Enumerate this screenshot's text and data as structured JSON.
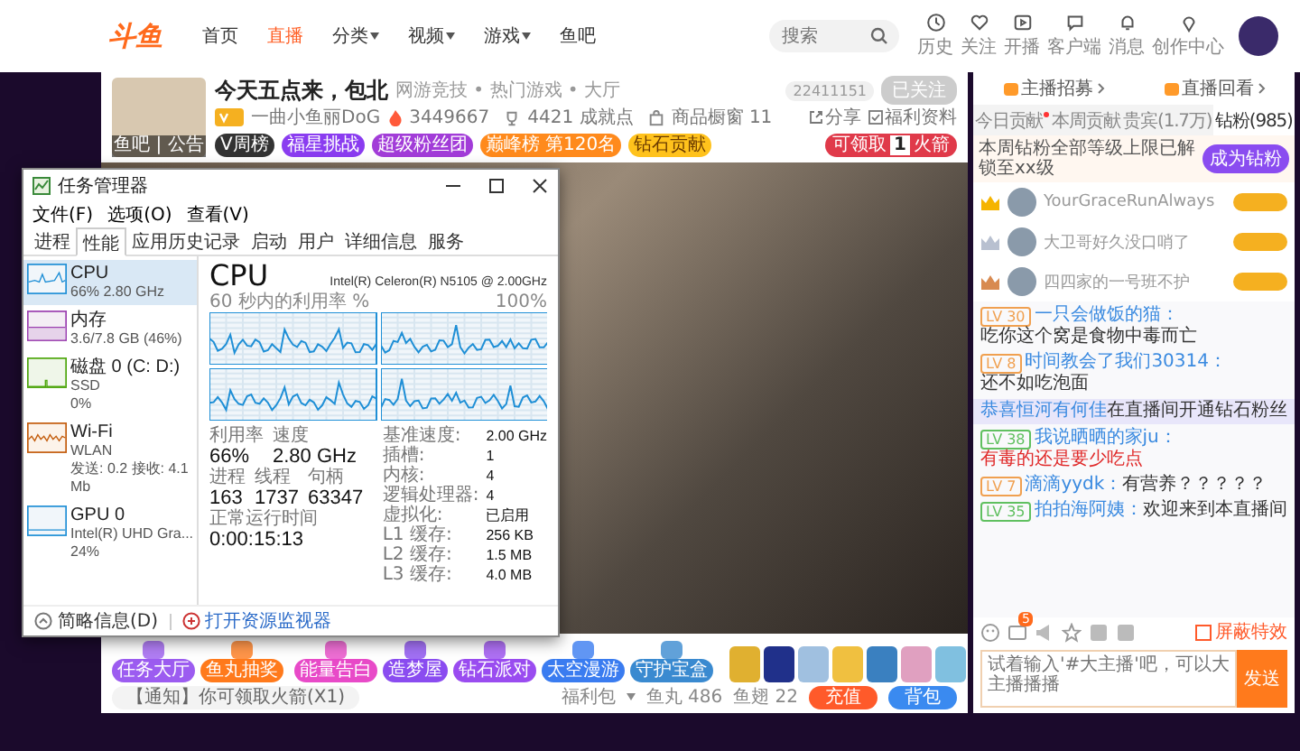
{
  "nav": {
    "logo": "斗鱼",
    "items": [
      {
        "label": "首页",
        "selected": false,
        "dropdown": false
      },
      {
        "label": "直播",
        "selected": true,
        "dropdown": false
      },
      {
        "label": "分类",
        "selected": false,
        "dropdown": true
      },
      {
        "label": "视频",
        "selected": false,
        "dropdown": true
      },
      {
        "label": "游戏",
        "selected": false,
        "dropdown": true
      },
      {
        "label": "鱼吧",
        "selected": false,
        "dropdown": false
      }
    ],
    "search": {
      "placeholder": "搜索"
    },
    "tools": [
      {
        "label": "历史",
        "kind": "clock"
      },
      {
        "label": "关注",
        "kind": "heart"
      },
      {
        "label": "开播",
        "kind": "play"
      },
      {
        "label": "客户端",
        "kind": "chat"
      },
      {
        "label": "消息",
        "kind": "bell"
      },
      {
        "label": "创作中心",
        "kind": "pin"
      }
    ]
  },
  "room": {
    "avatar_caption": "鱼吧 | 公告",
    "title": "今天五点来，包北",
    "category": "网游竞技 • 热门游戏 • 大厅",
    "room_id": "22411151",
    "follow": "已关注",
    "streamer": "一曲小鱼丽DoG",
    "heat": "3449667",
    "stats": [
      {
        "kind": "trophy",
        "label": "4421 成就点"
      },
      {
        "kind": "shop",
        "label": "商品橱窗 11"
      }
    ],
    "pills": [
      {
        "label": "V周榜",
        "color": "#333333"
      },
      {
        "label": "福星挑战",
        "color": "#8a3cf0"
      },
      {
        "label": "超级粉丝团",
        "color": "#a23cd8"
      },
      {
        "label": "巅峰榜 第120名",
        "color": "#ff8a1c"
      },
      {
        "label": "钻石贡献",
        "color": "#ffc21c"
      }
    ],
    "rocket": {
      "prefix": "可领取",
      "count": "1",
      "suffix": "火箭"
    },
    "actions": [
      {
        "kind": "share",
        "label": "分享"
      },
      {
        "kind": "check",
        "label": "福利资料"
      }
    ]
  },
  "task_manager": {
    "title": "任务管理器",
    "menu": [
      "文件(F)",
      "选项(O)",
      "查看(V)"
    ],
    "tabs": [
      {
        "label": "进程",
        "selected": false
      },
      {
        "label": "性能",
        "selected": true
      },
      {
        "label": "应用历史记录",
        "selected": false
      },
      {
        "label": "启动",
        "selected": false
      },
      {
        "label": "用户",
        "selected": false
      },
      {
        "label": "详细信息",
        "selected": false
      },
      {
        "label": "服务",
        "selected": false
      }
    ],
    "resources": [
      {
        "kind": "cpu",
        "name": "CPU",
        "detail": "66% 2.80 GHz",
        "selected": true
      },
      {
        "kind": "memory",
        "name": "内存",
        "detail": "3.6/7.8 GB (46%)",
        "selected": false
      },
      {
        "kind": "disk",
        "name": "磁盘 0 (C: D:)",
        "detail": "SSD",
        "extra": "0%",
        "selected": false
      },
      {
        "kind": "wifi",
        "name": "Wi-Fi",
        "detail": "WLAN",
        "extra": "发送: 0.2 接收: 4.1 Mb",
        "selected": false
      },
      {
        "kind": "gpu",
        "name": "GPU 0",
        "detail": "Intel(R) UHD Gra...",
        "extra": "24%",
        "selected": false
      }
    ],
    "heading": "CPU",
    "model": "Intel(R) Celeron(R) N5105 @ 2.00GHz",
    "graph_label": "60 秒内的利用率 %",
    "graph_max": "100%",
    "stats": [
      {
        "label": "利用率",
        "value": "66%"
      },
      {
        "label": "速度",
        "value": "2.80 GHz"
      },
      {
        "label": "进程",
        "value": "163"
      },
      {
        "label": "线程",
        "value": "1737"
      },
      {
        "label": "句柄",
        "value": "63347"
      },
      {
        "label": "正常运行时间",
        "value": "0:00:15:13"
      }
    ],
    "specs": [
      {
        "label": "基准速度:",
        "value": "2.00 GHz"
      },
      {
        "label": "插槽:",
        "value": "1"
      },
      {
        "label": "内核:",
        "value": "4"
      },
      {
        "label": "逻辑处理器:",
        "value": "4"
      },
      {
        "label": "虚拟化:",
        "value": "已启用"
      },
      {
        "label": "L1 缓存:",
        "value": "256 KB"
      },
      {
        "label": "L2 缓存:",
        "value": "1.5 MB"
      },
      {
        "label": "L3 缓存:",
        "value": "4.0 MB"
      }
    ],
    "footer": {
      "less": "简略信息(D)",
      "monitor": "打开资源监视器"
    }
  },
  "bottom_bar": {
    "features": [
      {
        "label": "任务大厅",
        "color": "#9c5cf0"
      },
      {
        "label": "鱼丸抽奖",
        "color": "#ff7a1c"
      }
    ],
    "gifts": [
      {
        "label": "能量告白",
        "color": "#e84ac8"
      },
      {
        "label": "造梦屋",
        "color": "#8a4cf0"
      },
      {
        "label": "钻石派对",
        "color": "#9a4cf0"
      },
      {
        "label": "太空漫游",
        "color": "#3a7cf0"
      },
      {
        "label": "守护宝盒",
        "color": "#3a8ad0"
      }
    ],
    "notice": "【通知】你可领取火箭(X1)",
    "welfare": "福利包",
    "fishball": "鱼丸 486",
    "fin": "鱼翅 22",
    "recharge": "充值",
    "backpack": "背包"
  },
  "chat": {
    "links": [
      "主播招募",
      "直播回看"
    ],
    "tabs": [
      {
        "label": "今日贡献",
        "selected": false,
        "dot": true
      },
      {
        "label": "本周贡献",
        "selected": false,
        "dot": false
      },
      {
        "label": "贵宾(1.7万)",
        "selected": false,
        "dot": false
      },
      {
        "label": "钻粉(985)",
        "selected": true,
        "dot": false
      }
    ],
    "promo": {
      "text": "本周钻粉全部等级上限已解锁至xx级",
      "button": "成为钻粉"
    },
    "ranking": [
      {
        "name": "YourGraceRunAlways",
        "color": "#f5b400"
      },
      {
        "name": "大卫哥好久没口哨了",
        "color": "#b8c0d0"
      },
      {
        "name": "四四家的一号班不护",
        "color": "#d88a50"
      }
    ],
    "messages": [
      {
        "kind": "message",
        "level": "LV 30",
        "color": "#f0a050",
        "name": "一只会做饭的猫：",
        "text": "吃你这个窝是食物中毒而亡",
        "alert": false
      },
      {
        "kind": "message",
        "level": "LV 8",
        "color": "#f0a050",
        "name": "时间教会了我们30314：",
        "text": "还不如吃泡面",
        "alert": false
      },
      {
        "kind": "system",
        "name": "恭喜恒河有何佳",
        "text": "在直播间开通钻石粉丝",
        "alert": false
      },
      {
        "kind": "message",
        "level": "LV 38",
        "color": "#60c060",
        "name": "我说晒晒的家ju：",
        "text": "有毒的还是要少吃点",
        "alert": true
      },
      {
        "kind": "message",
        "level": "LV 7",
        "color": "#f0a050",
        "name": "滴滴yydk：",
        "text": "有营养？？？？？",
        "alert": false
      },
      {
        "kind": "message",
        "level": "LV 35",
        "color": "#60c060",
        "name": "拍拍海阿姨：",
        "text": "欢迎来到本直播间",
        "alert": false
      }
    ],
    "toolbar_badge": "5",
    "block_effects": "屏蔽特效",
    "input": {
      "placeholder": "试着输入'#大主播'吧，可以大主播播播",
      "send": "发送"
    }
  }
}
